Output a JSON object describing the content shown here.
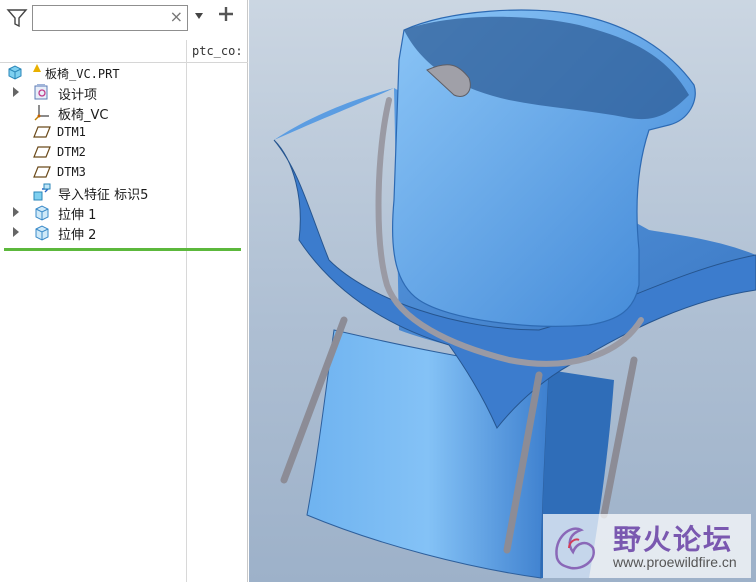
{
  "tree_toolbar": {
    "search_placeholder": "",
    "clear_glyph": "×",
    "icons": [
      "filter-icon",
      "dropdown-icon",
      "plus-icon"
    ]
  },
  "tree_header": {
    "column_label": "ptc_co:"
  },
  "model_tree": {
    "root": {
      "label": "板椅_VC.PRT",
      "icon": "part-icon"
    },
    "items": [
      {
        "label": "设计项",
        "icon": "design-items-icon",
        "expandable": true
      },
      {
        "label": "板椅_VC",
        "icon": "coordinate-system-icon",
        "expandable": false
      },
      {
        "label": "DTM1",
        "icon": "datum-plane-icon",
        "expandable": false
      },
      {
        "label": "DTM2",
        "icon": "datum-plane-icon",
        "expandable": false
      },
      {
        "label": "DTM3",
        "icon": "datum-plane-icon",
        "expandable": false
      },
      {
        "label": "导入特征 标识5",
        "icon": "import-feature-icon",
        "expandable": false
      },
      {
        "label": "拉伸 1",
        "icon": "extrude-icon",
        "expandable": true
      },
      {
        "label": "拉伸 2",
        "icon": "extrude-icon",
        "expandable": true
      }
    ]
  },
  "viewport": {
    "content": "3D model of chair with blue surfaces and grey frame"
  },
  "watermark": {
    "title": "野火论坛",
    "url": "www.proewildfire.cn"
  },
  "colors": {
    "surface_blue": "#4a8fde",
    "surface_light": "#7cb8f2",
    "frame_grey": "#8c8c96",
    "tree_green_line": "#5cb83c",
    "watermark_purple": "#7a58b0"
  }
}
